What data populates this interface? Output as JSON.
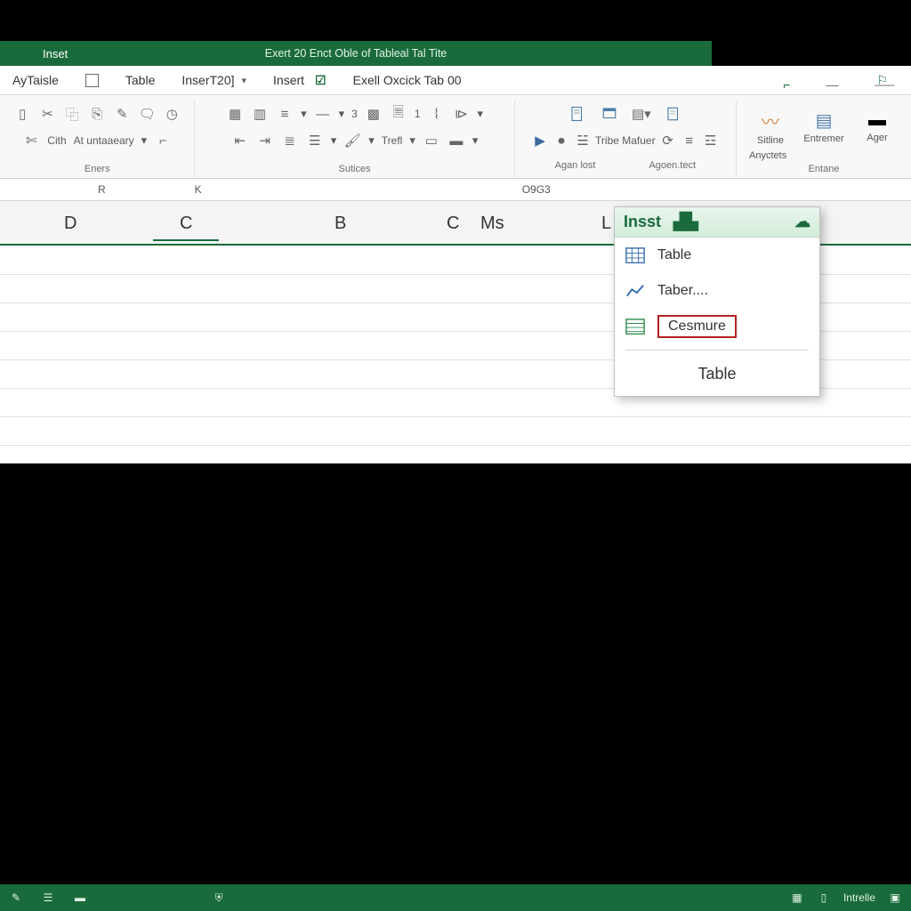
{
  "colors": {
    "accent": "#1a6b3b",
    "highlight_border": "#b52020"
  },
  "titlebar": {
    "tab_insert": "Inset",
    "title": "Exert 20 Enct Oble of Tableal Tal Tite"
  },
  "tabstrip": {
    "item0": "AyTaisle",
    "item1": "Table",
    "item2": "InserT20]",
    "item3": "Insert",
    "item4": "Exell Oxcick Tab 00"
  },
  "ribbon": {
    "group0": {
      "label_cith": "Cith",
      "label_at": "At untaaeary",
      "caption": "Eners"
    },
    "group1": {
      "label_trell": "Trefl",
      "caption": "Sutices"
    },
    "group2": {
      "label_tribe": "Tribe Mafuer",
      "caption_left": "Agan lost",
      "caption_right": "Agoen.tect"
    },
    "group3": {
      "btn_sitline": "Sitline",
      "btn_anyctets": "Anyctets",
      "btn_entremer": "Entremer",
      "btn_ager": "Ager",
      "caption": "Entane"
    }
  },
  "formulabar": {
    "left": "R",
    "mid": "K",
    "right": "O9G3"
  },
  "columns": {
    "d": "D",
    "c": "C",
    "b": "B",
    "c2": "C",
    "ms": "Ms",
    "l": "L"
  },
  "dropdown": {
    "header": "Insst",
    "item_table": "Table",
    "item_taber": "Taber....",
    "item_cesmure": "Cesmure",
    "footer": "Table"
  },
  "statusbar": {
    "label": "Intrelle"
  }
}
